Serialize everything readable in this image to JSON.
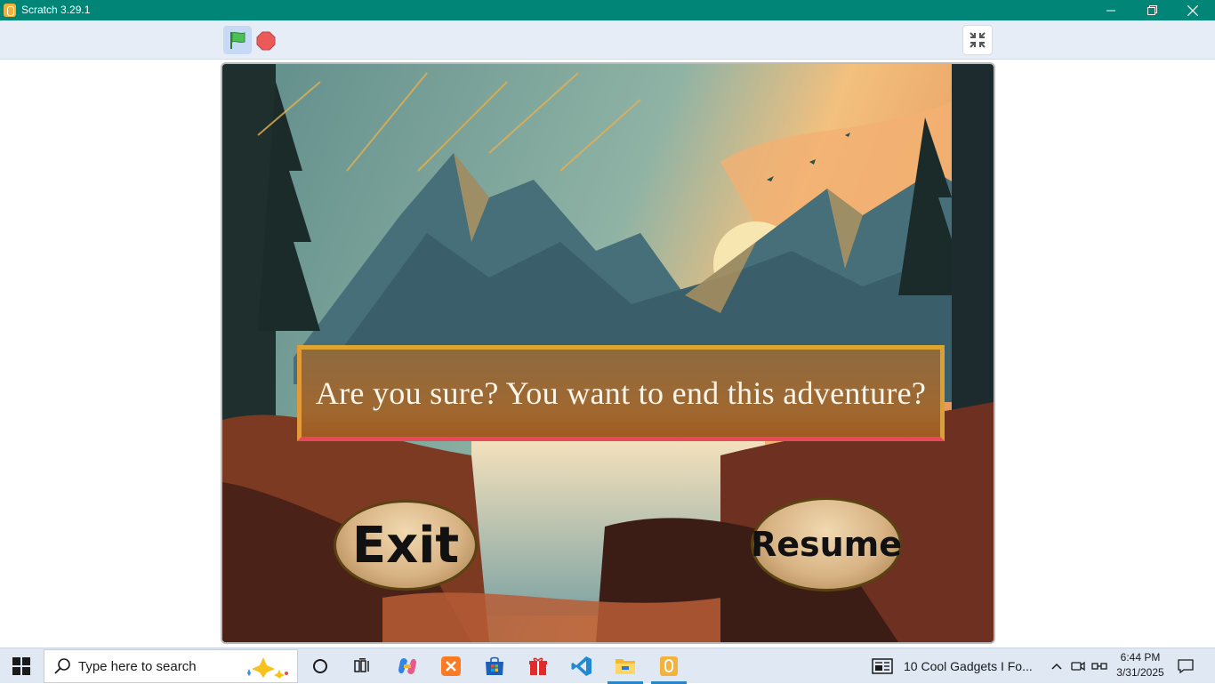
{
  "window": {
    "title": "Scratch 3.29.1",
    "icons": {
      "app": "scratch-app-icon",
      "minimize": "minimize-icon",
      "maximize": "restore-icon",
      "close": "close-icon"
    }
  },
  "toolbar": {
    "green_flag": "green-flag-icon",
    "stop": "stop-icon",
    "unfullscreen": "unfullscreen-icon"
  },
  "stage": {
    "dialog_text": "Are you sure? You want to end this adventure?",
    "exit_label": "Exit",
    "resume_label": "Resume"
  },
  "taskbar": {
    "search_placeholder": "Type here to search",
    "news_text": "10 Cool Gadgets I Fo...",
    "time": "6:44 PM",
    "date": "3/31/2025",
    "apps": [
      "cortana",
      "task-view",
      "copilot",
      "xampp",
      "microsoft-store",
      "gift-app",
      "vscode",
      "file-explorer",
      "scratch"
    ]
  },
  "colors": {
    "titlebar": "#008577",
    "toolbar": "#e7edf6",
    "dialog_border": "#e0a530",
    "taskbar": "#dfe8f3"
  }
}
